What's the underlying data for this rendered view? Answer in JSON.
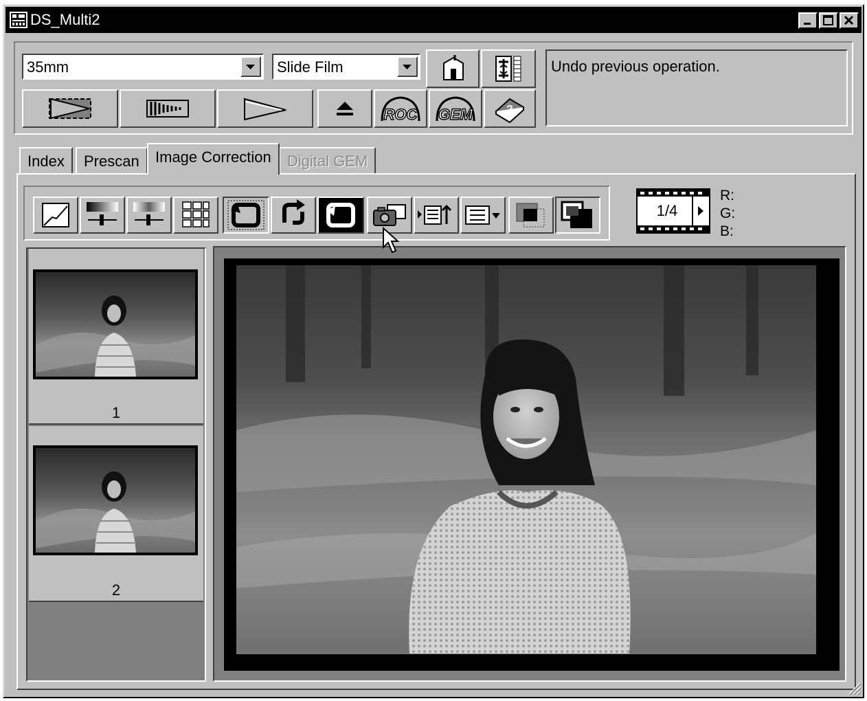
{
  "window": {
    "title": "DS_Multi2"
  },
  "toolbar": {
    "film_format": "35mm",
    "film_type": "Slide Film",
    "status_message": "Undo previous operation.",
    "buttons_row1": [
      {
        "name": "preferences-icon"
      },
      {
        "name": "scan-settings-icon"
      }
    ],
    "buttons_row2": [
      {
        "name": "index-scan-icon"
      },
      {
        "name": "prescan-icon"
      },
      {
        "name": "scan-icon"
      },
      {
        "name": "eject-icon"
      },
      {
        "name": "roc-icon",
        "label": "ROC"
      },
      {
        "name": "gem-icon",
        "label": "GEM"
      },
      {
        "name": "help-icon"
      }
    ]
  },
  "tabs": [
    {
      "label": "Index",
      "active": false,
      "enabled": true
    },
    {
      "label": "Prescan",
      "active": false,
      "enabled": true
    },
    {
      "label": "Image Correction",
      "active": true,
      "enabled": true
    },
    {
      "label": "Digital GEM",
      "active": false,
      "enabled": false
    }
  ],
  "image_tools": [
    "tone-curve-icon",
    "brightness-contrast-icon",
    "color-balance-icon",
    "variations-icon",
    "rotate-left-icon",
    "rotate-right-icon",
    "flip-icon",
    "snapshot-icon",
    "apply-icon",
    "job-menu-icon",
    "before-icon",
    "after-icon"
  ],
  "frame_counter": {
    "value": "1/4"
  },
  "rgb_readout": {
    "r": "R:",
    "g": "G:",
    "b": "B:"
  },
  "thumbnails": [
    {
      "number": "1"
    },
    {
      "number": "2"
    }
  ]
}
